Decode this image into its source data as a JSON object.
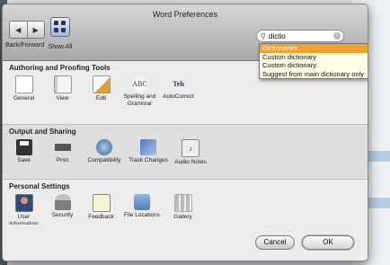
{
  "window": {
    "title": "Word Preferences"
  },
  "toolbar": {
    "back_forward_label": "Back/Forward",
    "back_glyph": "◀",
    "forward_glyph": "▶",
    "show_all_label": "Show All"
  },
  "search": {
    "value": "dictio",
    "icon": "search-icon",
    "clear_icon": "clear-icon"
  },
  "dropdown": {
    "items": [
      "Dictionaries",
      "Custom dictionary",
      "Custom dictionary:",
      "Suggest from main dictionary only"
    ],
    "selected_index": 0,
    "highlight_color": "#f1a22d"
  },
  "sections": [
    {
      "title": "Authoring and Proofing Tools",
      "items": [
        {
          "label": "General",
          "icon": "general-icon"
        },
        {
          "label": "View",
          "icon": "view-icon"
        },
        {
          "label": "Edit",
          "icon": "edit-icon"
        },
        {
          "label": "Spelling and Grammar",
          "icon": "spelling-grammar-icon",
          "glyph": "ABC"
        },
        {
          "label": "AutoCorrect",
          "icon": "autocorrect-icon",
          "glyph": "Teh"
        }
      ]
    },
    {
      "title": "Output and Sharing",
      "items": [
        {
          "label": "Save",
          "icon": "save-icon"
        },
        {
          "label": "Print",
          "icon": "print-icon"
        },
        {
          "label": "Compatibility",
          "icon": "compatibility-icon"
        },
        {
          "label": "Track Changes",
          "icon": "track-changes-icon"
        },
        {
          "label": "Audio Notes",
          "icon": "audio-notes-icon"
        }
      ]
    },
    {
      "title": "Personal Settings",
      "items": [
        {
          "label": "User Information",
          "icon": "user-information-icon"
        },
        {
          "label": "Security",
          "icon": "security-icon"
        },
        {
          "label": "Feedback",
          "icon": "feedback-icon"
        },
        {
          "label": "File Locations",
          "icon": "file-locations-icon"
        },
        {
          "label": "Gallery",
          "icon": "gallery-icon"
        }
      ]
    }
  ],
  "buttons": {
    "cancel": "Cancel",
    "ok": "OK"
  }
}
